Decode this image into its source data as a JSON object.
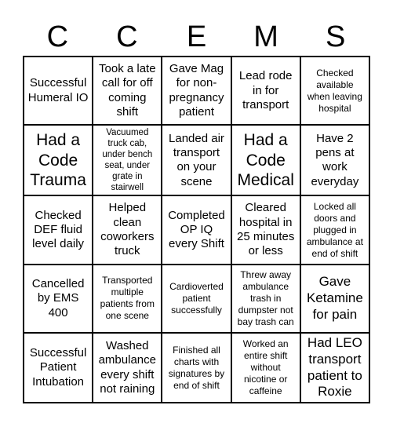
{
  "header": [
    "C",
    "C",
    "E",
    "M",
    "S"
  ],
  "cells": [
    "Successful Humeral IO",
    "Took a late call for off coming shift",
    "Gave Mag for non-pregnancy patient",
    "Lead rode in for transport",
    "Checked available when leaving hospital",
    "Had a Code Trauma",
    "Vacuumed truck cab, under bench seat, under grate in stairwell",
    "Landed air transport on your scene",
    "Had a Code Medical",
    "Have 2 pens at work everyday",
    "Checked DEF fluid level daily",
    "Helped clean coworkers truck",
    "Completed OP IQ every Shift",
    "Cleared hospital in 25 minutes or less",
    "Locked all doors and plugged in ambulance at end of shift",
    "Cancelled by EMS 400",
    "Transported multiple patients from one scene",
    "Cardioverted patient successfully",
    "Threw away ambulance trash in dumpster not bay trash can",
    "Gave Ketamine for pain",
    "Successful Patient Intubation",
    "Washed ambulance every shift not raining",
    "Finished all charts with signatures by end of shift",
    "Worked an entire shift without nicotine or caffeine",
    "Had LEO transport patient to Roxie"
  ]
}
